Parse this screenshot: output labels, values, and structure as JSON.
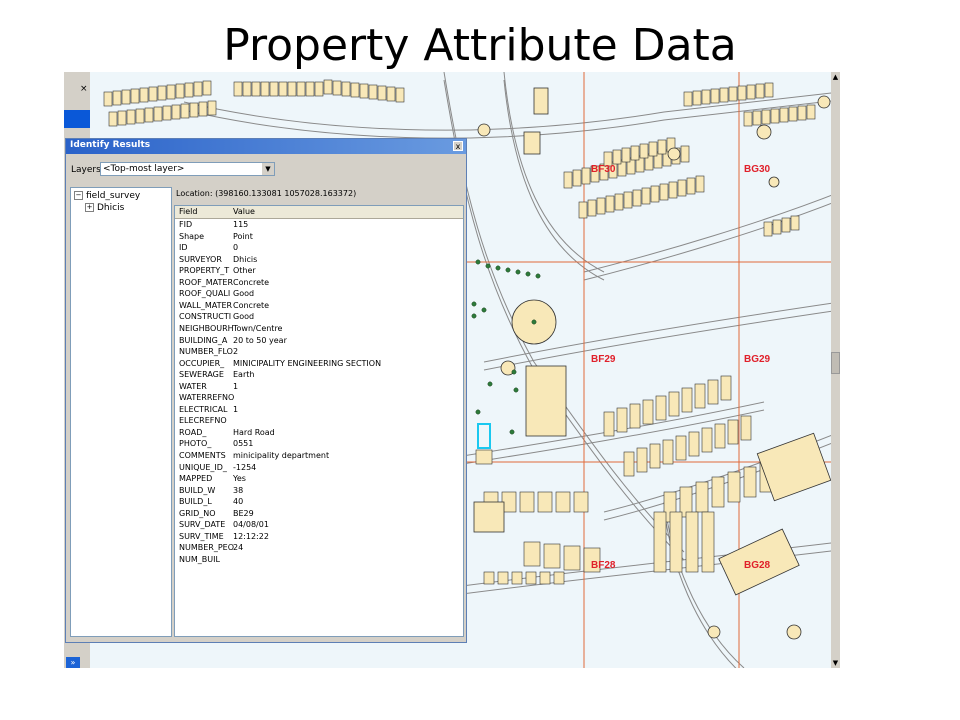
{
  "slide": {
    "title": "Property Attribute Data"
  },
  "sidebar": {
    "close_label": "×",
    "arrow_label": "»"
  },
  "dialog": {
    "title": "Identify Results",
    "close_label": "x",
    "layers_label": "Layers:",
    "layers_value": "<Top-most layer>",
    "tree_root": "field_survey",
    "tree_child": "Dhicis",
    "location": "Location: (398160.133081 1057028.163372)",
    "columns": [
      "Field",
      "Value"
    ],
    "rows": [
      [
        "FID",
        "115"
      ],
      [
        "Shape",
        "Point"
      ],
      [
        "ID",
        "0"
      ],
      [
        "SURVEYOR",
        "Dhicis"
      ],
      [
        "PROPERTY_T",
        "Other"
      ],
      [
        "ROOF_MATER",
        "Concrete"
      ],
      [
        "ROOF_QUALI",
        "Good"
      ],
      [
        "WALL_MATER",
        "Concrete"
      ],
      [
        "CONSTRUCTI",
        "Good"
      ],
      [
        "NEIGHBOURH",
        "Town/Centre"
      ],
      [
        "BUILDING_A",
        "20 to 50 year"
      ],
      [
        "NUMBER_FLO",
        "2"
      ],
      [
        "OCCUPIER_",
        "MINICIPALITY ENGINEERING SECTION"
      ],
      [
        "SEWERAGE",
        "Earth"
      ],
      [
        "WATER",
        "1"
      ],
      [
        "WATERREFNO",
        ""
      ],
      [
        "ELECTRICAL",
        "1"
      ],
      [
        "ELECREFNO",
        ""
      ],
      [
        "ROAD_",
        "Hard Road"
      ],
      [
        "PHOTO_",
        "0551"
      ],
      [
        "COMMENTS",
        "minicipality department"
      ],
      [
        "UNIQUE_ID_",
        "-1254"
      ],
      [
        "MAPPED",
        "Yes"
      ],
      [
        "BUILD_W",
        "38"
      ],
      [
        "BUILD_L",
        "40"
      ],
      [
        "GRID_NO",
        "BE29"
      ],
      [
        "SURV_DATE",
        "04/08/01"
      ],
      [
        "SURV_TIME",
        "12:12:22"
      ],
      [
        "NUMBER_PEO",
        "24"
      ],
      [
        "NUM_BUIL",
        ""
      ]
    ]
  },
  "map": {
    "grid_labels": [
      "BF30",
      "BG30",
      "BF29",
      "BG29",
      "BF28",
      "BG28"
    ],
    "grid_color": "#e06a3a",
    "label_color": "#e0202a",
    "road_color": "#8a8a8a",
    "building_fill": "#f8e8b8"
  }
}
